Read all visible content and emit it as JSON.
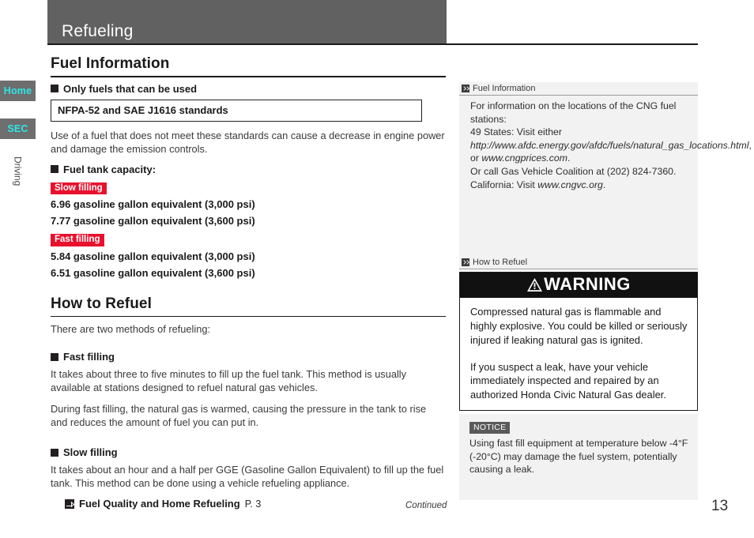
{
  "sidebar": {
    "tabs": [
      {
        "label": "Home",
        "name": "home"
      },
      {
        "label": "SEC",
        "name": "sec"
      }
    ],
    "vertical_label": "Driving"
  },
  "header": {
    "title": "Refueling"
  },
  "left": {
    "section1": {
      "title": "Fuel Information",
      "subhead1": "Only fuels that can be used",
      "standards_box": "NFPA-52 and SAE J1616 standards",
      "paragraph1": "Use of a fuel that does not meet these standards can cause a decrease in engine power and damage the emission controls.",
      "subhead2": "Fuel tank capacity:",
      "badge_slow": "Slow filling",
      "slow_line1": "6.96 gasoline gallon equivalent (3,000 psi)",
      "slow_line2": "7.77 gasoline gallon equivalent (3,600 psi)",
      "badge_fast": "Fast filling",
      "fast_line1": "5.84 gasoline gallon equivalent (3,000 psi)",
      "fast_line2": "6.51 gasoline gallon equivalent (3,600 psi)"
    },
    "section2": {
      "title": "How to Refuel",
      "intro": "There are two methods of refueling:",
      "subhead_fast": "Fast filling",
      "fast_p1": "It takes about three to five minutes to fill up the fuel tank. This method is usually available at stations designed to refuel natural gas vehicles.",
      "fast_p2": "During fast filling, the natural gas is warmed, causing the pressure in the tank to rise and reduces the amount of fuel you can put in.",
      "subhead_slow": "Slow filling",
      "slow_p1": "It takes about an hour and a half per GGE (Gasoline Gallon Equivalent) to fill up the fuel tank. This method can be done using a vehicle refueling appliance.",
      "reference_label": "Fuel Quality and Home Refueling",
      "reference_page": "P. 3"
    }
  },
  "right": {
    "note1": {
      "head": "Fuel Information",
      "l1": "For information on the locations of the CNG fuel stations:",
      "l2_prefix": "49 States: Visit either ",
      "l2_url1": "http://www.afdc.energy.gov/afdc/fuels/natural_gas_locations.html",
      "l2_mid": ", or ",
      "l2_url2": "www.cngprices.com",
      "l2_suffix": ".",
      "l3": "Or call Gas Vehicle Coalition at (202) 824-7360.",
      "l4_prefix": "California: Visit ",
      "l4_url": "www.cngvc.org",
      "l4_suffix": "."
    },
    "note2": {
      "head": "How to Refuel"
    },
    "warning": {
      "title": "WARNING",
      "p1": "Compressed natural gas is flammable and highly explosive. You could be killed or seriously injured if leaking natural gas is ignited.",
      "p2": "If you suspect a leak, have your vehicle immediately inspected and repaired by an authorized Honda Civic Natural Gas dealer."
    },
    "notice": {
      "badge": "NOTICE",
      "text": "Using fast fill equipment at temperature below -4°F (-20°C) may damage the fuel system, potentially causing a leak."
    }
  },
  "footer": {
    "continued": "Continued",
    "page_number": "13"
  },
  "colors": {
    "header_gray": "#616161",
    "tab_gray": "#6e6e6e",
    "tab_text_cyan": "#2ee7e7",
    "badge_red": "#e8112d",
    "warning_black": "#111111",
    "notice_gray": "#5a5a5a",
    "panel_gray": "#f2f2f2"
  }
}
